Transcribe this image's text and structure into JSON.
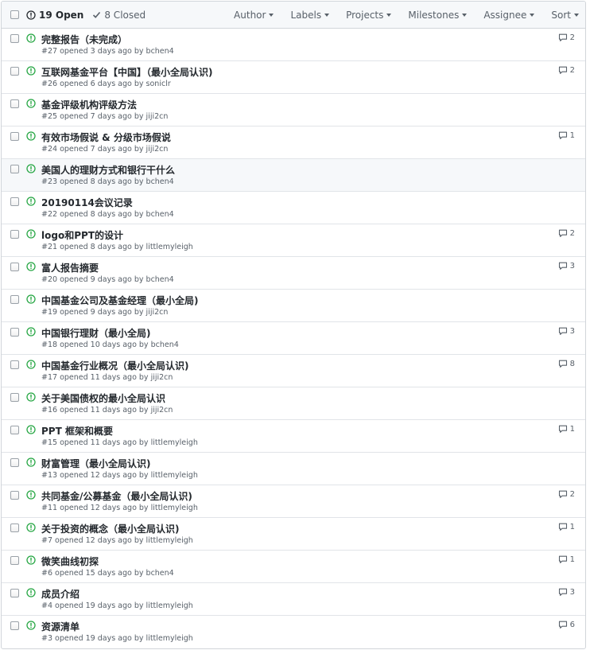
{
  "header": {
    "open_label": "19 Open",
    "closed_label": "8 Closed",
    "filters": [
      "Author",
      "Labels",
      "Projects",
      "Milestones",
      "Assignee",
      "Sort"
    ]
  },
  "colors": {
    "open_icon": "#28a745",
    "header_bg": "#f6f8fa",
    "border": "#d1d5da",
    "muted": "#586069"
  },
  "issues": [
    {
      "title": "完整报告（未完成）",
      "meta": "#27 opened 3 days ago by bchen4",
      "comments": "2"
    },
    {
      "title": "互联网基金平台【中国】（最小全局认识)",
      "meta": "#26 opened 6 days ago by soniclr",
      "comments": "2"
    },
    {
      "title": "基金评级机构评级方法",
      "meta": "#25 opened 7 days ago by jiji2cn",
      "comments": ""
    },
    {
      "title": "有效市场假说 & 分级市场假说",
      "meta": "#24 opened 7 days ago by jiji2cn",
      "comments": "1"
    },
    {
      "title": "美国人的理财方式和银行干什么",
      "meta": "#23 opened 8 days ago by bchen4",
      "comments": ""
    },
    {
      "title": "20190114会议记录",
      "meta": "#22 opened 8 days ago by bchen4",
      "comments": ""
    },
    {
      "title": "logo和PPT的设计",
      "meta": "#21 opened 8 days ago by littlemyleigh",
      "comments": "2"
    },
    {
      "title": "富人报告摘要",
      "meta": "#20 opened 9 days ago by bchen4",
      "comments": "3"
    },
    {
      "title": "中国基金公司及基金经理（最小全局)",
      "meta": "#19 opened 9 days ago by jiji2cn",
      "comments": ""
    },
    {
      "title": "中国银行理财（最小全局)",
      "meta": "#18 opened 10 days ago by bchen4",
      "comments": "3"
    },
    {
      "title": "中国基金行业概况（最小全局认识)",
      "meta": "#17 opened 11 days ago by jiji2cn",
      "comments": "8"
    },
    {
      "title": "关于美国债权的最小全局认识",
      "meta": "#16 opened 11 days ago by jiji2cn",
      "comments": ""
    },
    {
      "title": "PPT 框架和概要",
      "meta": "#15 opened 11 days ago by littlemyleigh",
      "comments": "1"
    },
    {
      "title": "财富管理（最小全局认识)",
      "meta": "#13 opened 12 days ago by littlemyleigh",
      "comments": ""
    },
    {
      "title": "共同基金/公募基金（最小全局认识)",
      "meta": "#11 opened 12 days ago by littlemyleigh",
      "comments": "2"
    },
    {
      "title": "关于投资的概念（最小全局认识)",
      "meta": "#7 opened 12 days ago by littlemyleigh",
      "comments": "1"
    },
    {
      "title": "微笑曲线初探",
      "meta": "#6 opened 15 days ago by bchen4",
      "comments": "1"
    },
    {
      "title": "成员介绍",
      "meta": "#4 opened 19 days ago by littlemyleigh",
      "comments": "3"
    },
    {
      "title": "资源清单",
      "meta": "#3 opened 19 days ago by littlemyleigh",
      "comments": "6"
    }
  ]
}
